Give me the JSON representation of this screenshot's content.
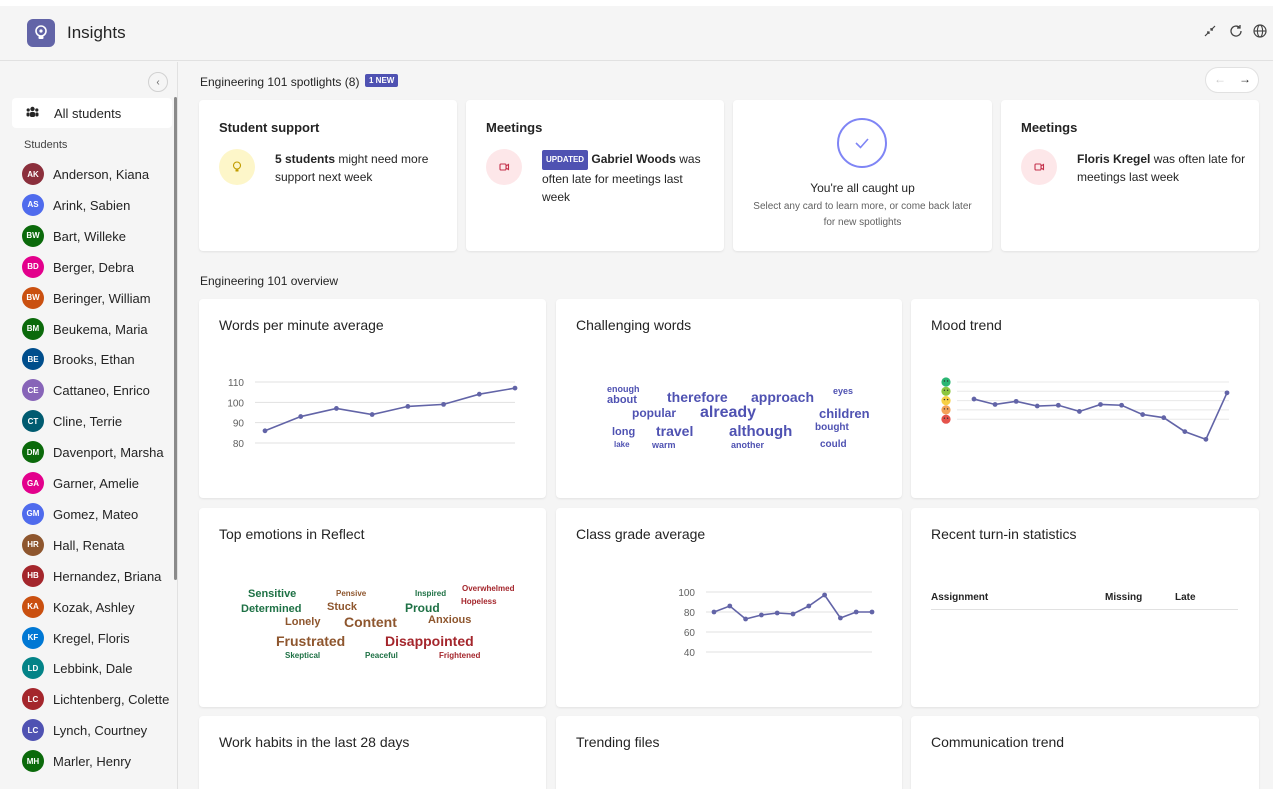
{
  "header": {
    "title": "Insights"
  },
  "sidebar": {
    "all_students": "All students",
    "students_header": "Students",
    "students": [
      {
        "initials": "AK",
        "name": "Anderson, Kiana",
        "color": "#8b2f3c"
      },
      {
        "initials": "AS",
        "name": "Arink, Sabien",
        "color": "#4f6bed"
      },
      {
        "initials": "BW",
        "name": "Bart, Willeke",
        "color": "#0b6a0b"
      },
      {
        "initials": "BD",
        "name": "Berger, Debra",
        "color": "#e3008c"
      },
      {
        "initials": "BW",
        "name": "Beringer, William",
        "color": "#ca5010"
      },
      {
        "initials": "BM",
        "name": "Beukema, Maria",
        "color": "#0b6a0b"
      },
      {
        "initials": "BE",
        "name": "Brooks, Ethan",
        "color": "#004e8c"
      },
      {
        "initials": "CE",
        "name": "Cattaneo, Enrico",
        "color": "#8764b8"
      },
      {
        "initials": "CT",
        "name": "Cline, Terrie",
        "color": "#005b70"
      },
      {
        "initials": "DM",
        "name": "Davenport, Marsha",
        "color": "#0b6a0b"
      },
      {
        "initials": "GA",
        "name": "Garner, Amelie",
        "color": "#e3008c"
      },
      {
        "initials": "GM",
        "name": "Gomez, Mateo",
        "color": "#4f6bed"
      },
      {
        "initials": "HR",
        "name": "Hall, Renata",
        "color": "#8e562e"
      },
      {
        "initials": "HB",
        "name": "Hernandez, Briana",
        "color": "#a4262c"
      },
      {
        "initials": "KA",
        "name": "Kozak, Ashley",
        "color": "#ca5010"
      },
      {
        "initials": "KF",
        "name": "Kregel, Floris",
        "color": "#0078d4"
      },
      {
        "initials": "LD",
        "name": "Lebbink, Dale",
        "color": "#038387"
      },
      {
        "initials": "LC",
        "name": "Lichtenberg, Colette",
        "color": "#a4262c"
      },
      {
        "initials": "LC",
        "name": "Lynch, Courtney",
        "color": "#4f52b2"
      },
      {
        "initials": "MH",
        "name": "Marler, Henry",
        "color": "#0b6a0b"
      }
    ]
  },
  "spotlights": {
    "title": "Engineering 101 spotlights (8)",
    "badge": "1 NEW",
    "cards": [
      {
        "title": "Student support",
        "bold": "5 students",
        "text": " might need more support next week"
      },
      {
        "title": "Meetings",
        "badge": "UPDATED",
        "bold": "Gabriel Woods",
        "text": " was often late for meetings last week"
      },
      {
        "caught_title": "You're all caught up",
        "caught_sub": "Select any card to learn more, or come back later for new spotlights"
      },
      {
        "title": "Meetings",
        "bold": "Floris Kregel",
        "text": " was often late for meetings last week"
      }
    ]
  },
  "overview": {
    "title": "Engineering 101 overview",
    "cards": {
      "wpm": "Words per minute average",
      "challenging": "Challenging words",
      "mood": "Mood trend",
      "emotions": "Top emotions in Reflect",
      "grade": "Class grade average",
      "turnin": "Recent turn-in statistics",
      "habits": "Work habits in the last 28 days",
      "files": "Trending files",
      "communication": "Communication trend"
    },
    "turnin_columns": [
      "Assignment",
      "Missing",
      "Late"
    ],
    "challenging_words": [
      "enough",
      "about",
      "therefore",
      "approach",
      "eyes",
      "popular",
      "already",
      "children",
      "long",
      "travel",
      "although",
      "bought",
      "lake",
      "warm",
      "another",
      "could"
    ],
    "emotion_words": [
      "Sensitive",
      "Pensive",
      "Inspired",
      "Overwhelmed",
      "Determined",
      "Stuck",
      "Proud",
      "Hopeless",
      "Lonely",
      "Content",
      "Anxious",
      "Frustrated",
      "Disappointed",
      "Skeptical",
      "Peaceful",
      "Frightened"
    ]
  },
  "chart_data": [
    {
      "type": "line",
      "title": "Words per minute average",
      "yticks": [
        80,
        90,
        100,
        110
      ],
      "ylim": [
        80,
        110
      ],
      "values": [
        86,
        93,
        97,
        94,
        98,
        99,
        104,
        107
      ],
      "color": "#6264a7"
    },
    {
      "type": "line",
      "title": "Mood trend",
      "ylim": [
        1,
        5
      ],
      "values": [
        3.9,
        3.55,
        3.75,
        3.45,
        3.5,
        3.1,
        3.55,
        3.5,
        2.9,
        2.7,
        1.8,
        1.3,
        4.3
      ],
      "color": "#6264a7"
    },
    {
      "type": "line",
      "title": "Class grade average",
      "yticks": [
        40,
        60,
        80,
        100
      ],
      "ylim": [
        40,
        100
      ],
      "values": [
        80,
        86,
        73,
        77,
        79,
        78,
        86,
        97,
        74,
        80,
        80
      ],
      "color": "#6264a7"
    }
  ]
}
